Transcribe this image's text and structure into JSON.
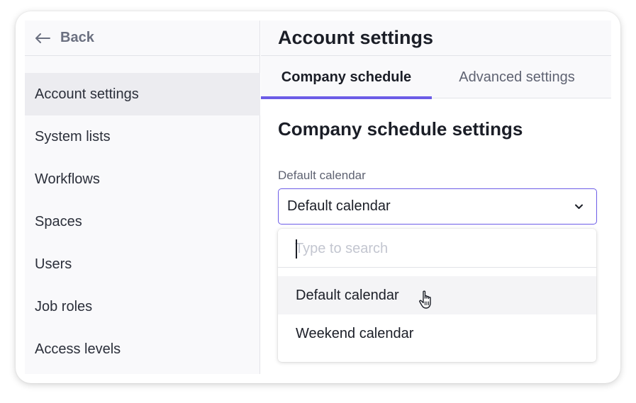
{
  "sidebar": {
    "back_label": "Back",
    "items": [
      {
        "label": "Account settings",
        "active": true
      },
      {
        "label": "System lists"
      },
      {
        "label": "Workflows"
      },
      {
        "label": "Spaces"
      },
      {
        "label": "Users"
      },
      {
        "label": "Job roles"
      },
      {
        "label": "Access levels"
      }
    ]
  },
  "main": {
    "title": "Account settings",
    "tabs": [
      {
        "label": "Company schedule",
        "active": true
      },
      {
        "label": "Advanced settings"
      }
    ],
    "section_title": "Company schedule settings",
    "field": {
      "label": "Default calendar",
      "value": "Default calendar"
    },
    "dropdown": {
      "search_placeholder": "Type to search",
      "options": [
        {
          "label": "Default calendar",
          "hovered": true
        },
        {
          "label": "Weekend calendar"
        }
      ]
    }
  },
  "colors": {
    "accent": "#6c5ce7",
    "sidebar_bg": "#f9f9fb",
    "active_item_bg": "#ececf0",
    "border": "#e2e3e8"
  },
  "icons": {
    "back": "arrow-left-icon",
    "select": "chevron-down-icon",
    "pointer": "hand-pointer-cursor-icon"
  }
}
